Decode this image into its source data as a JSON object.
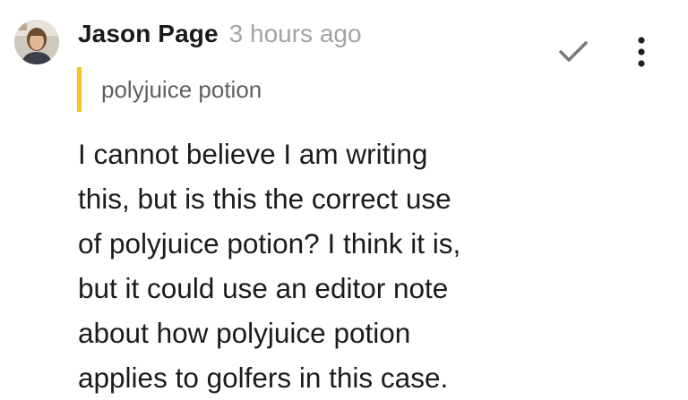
{
  "comment": {
    "author": "Jason Page",
    "timestamp": "3 hours ago",
    "quote": "polyjuice potion",
    "body_lines": [
      "I cannot believe I am writing",
      "this, but is this the correct use",
      "of polyjuice potion? I think it is,",
      "but it could use an editor note",
      "about how polyjuice potion",
      "applies to golfers in this case."
    ]
  },
  "icons": {
    "avatar": "avatar-photo",
    "resolve": "checkmark-icon",
    "more": "more-vertical-icon"
  },
  "colors": {
    "quote_bar": "#f3c425",
    "timestamp": "#a3a3a3",
    "icon": "#7a7a7a"
  }
}
